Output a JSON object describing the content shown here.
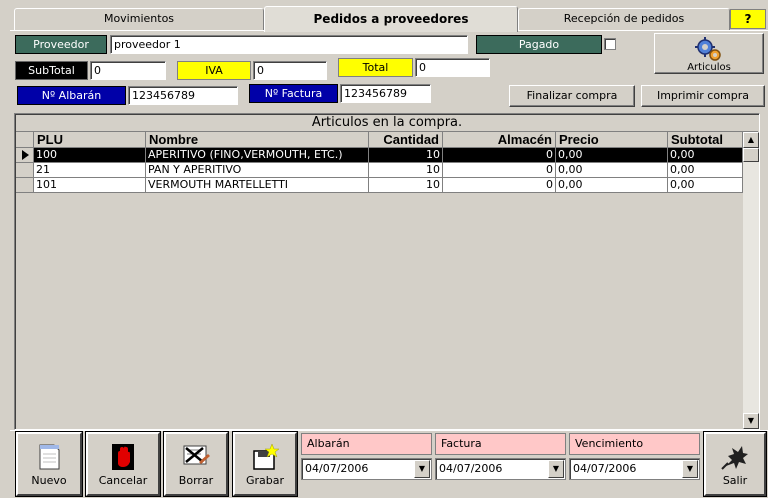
{
  "tabs": [
    {
      "label": "Movimientos"
    },
    {
      "label": "Pedidos a proveedores"
    },
    {
      "label": "Recepción de pedidos"
    }
  ],
  "help_label": "?",
  "form": {
    "proveedor_label": "Proveedor",
    "proveedor_value": "proveedor 1",
    "pagado_label": "Pagado",
    "subtotal_label": "SubTotal",
    "subtotal_value": "0",
    "iva_label": "IVA",
    "iva_value": "0",
    "total_label": "Total",
    "total_value": "0",
    "albaran_label": "Nº Albarán",
    "albaran_value": "123456789",
    "factura_label": "Nº Factura",
    "factura_value": "123456789"
  },
  "buttons": {
    "articulos": "Articulos",
    "finalizar": "Finalizar compra",
    "imprimir": "Imprimir compra"
  },
  "grid": {
    "title": "Articulos en la compra.",
    "columns": [
      "PLU",
      "Nombre",
      "Cantidad",
      "Almacén",
      "Precio",
      "Subtotal"
    ],
    "rows": [
      {
        "plu": "100",
        "nombre": "APERITIVO (FINO,VERMOUTH, ETC.)",
        "cantidad": "10",
        "almacen": "0",
        "precio": "0,00",
        "subtotal": "0,00"
      },
      {
        "plu": "21",
        "nombre": "PAN Y APERITIVO",
        "cantidad": "10",
        "almacen": "0",
        "precio": "0,00",
        "subtotal": "0,00"
      },
      {
        "plu": "101",
        "nombre": "VERMOUTH MARTELLETTI",
        "cantidad": "10",
        "almacen": "0",
        "precio": "0,00",
        "subtotal": "0,00"
      }
    ]
  },
  "bottom": {
    "nuevo": "Nuevo",
    "cancelar": "Cancelar",
    "borrar": "Borrar",
    "grabar": "Grabar",
    "salir": "Salir",
    "albaran_label": "Albarán",
    "albaran_date": "04/07/2006",
    "factura_label": "Factura",
    "factura_date": "04/07/2006",
    "vencimiento_label": "Vencimiento",
    "vencimiento_date": "04/07/2006"
  },
  "colors": {
    "label_green": "#3c6b5c",
    "label_blue": "#0000a8",
    "label_yellow": "#ffff00",
    "date_label_pink": "#ffc8c8"
  }
}
